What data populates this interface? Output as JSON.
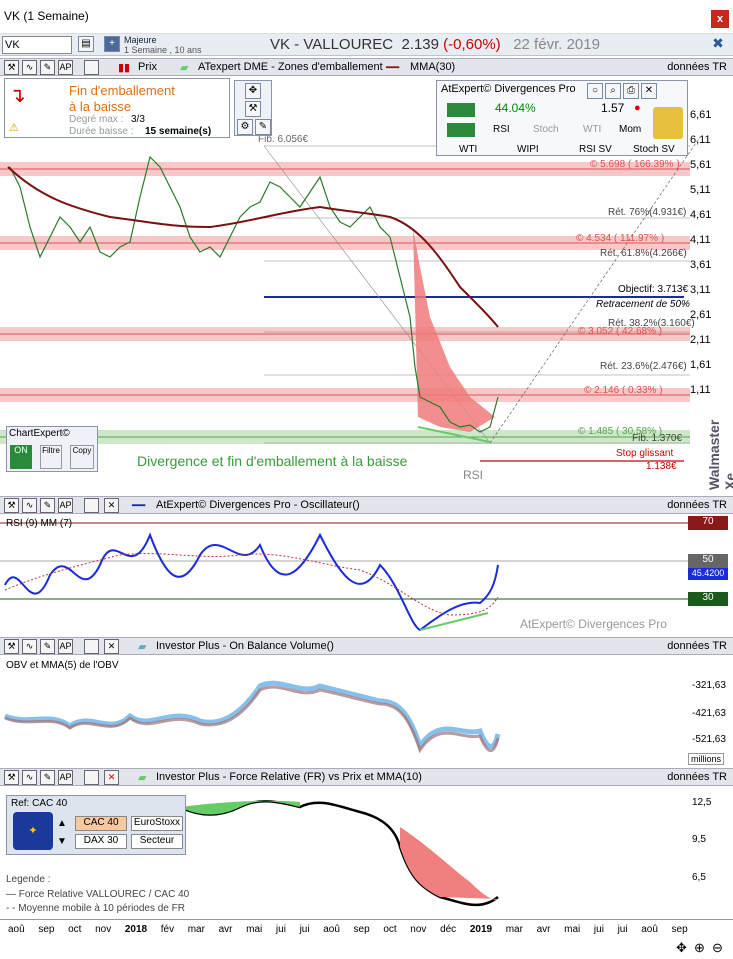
{
  "window": {
    "title": "VK (1 Semaine)",
    "close": "x"
  },
  "toolbar": {
    "symbol": "VK",
    "majeure_label": "Majeure",
    "majeure_sub": "1 Semaine , 10 ans",
    "headline_name": "VK - VALLOUREC",
    "headline_price": "2.139",
    "headline_change": "(-0,60%)",
    "headline_date": "22 févr. 2019"
  },
  "panel1": {
    "prix": "Prix",
    "zones": "ATexpert DME - Zones d'emballement",
    "mma": "MMA(30)",
    "donnees": "données TR",
    "alert_title": "Fin d'emballement",
    "alert_sub": "à la baisse",
    "degre_label": "Degré max :",
    "degre_value": "3/3",
    "duree_label": "Durée baisse :",
    "duree_value": "15 semaine(s)",
    "fib_top": "Fib. 6.056€",
    "level_5698": "© 5.698 ( 166.39% )",
    "level_4534": "© 4.534 ( 111.97% )",
    "level_3052": "© 3.052 ( 42.68% )",
    "level_2146": "© 2.146 ( 0.33% )",
    "level_1485": "© 1.485 ( 30.58% )",
    "ret76": "Rét. 76%(4.931€)",
    "ret618": "Rét. 61.8%(4.266€)",
    "objectif": "Objectif: 3.713€",
    "retr50": "Retracement de 50%",
    "ret382": "Rét. 38.2%(3.160€)",
    "ret236": "Rét. 23.6%(2.476€)",
    "fib_bot": "Fib. 1.370€",
    "stop": "Stop glissant",
    "stop_val": "1.138€",
    "rsi": "RSI",
    "divergence": "Divergence  et fin d'emballement à la baisse",
    "chartexpert": "ChartExpert©",
    "btn_on": "ON",
    "btn_filtre": "Filtre",
    "btn_copy": "Copy",
    "yticks": [
      "6,61",
      "6,11",
      "5,61",
      "5,11",
      "4,61",
      "4,11",
      "3,61",
      "3,11",
      "2,61",
      "2,11",
      "1,61",
      "1,11"
    ],
    "watermark": "Walmaster Xe"
  },
  "divpro": {
    "title": "AtExpert© Divergences Pro",
    "pct": "44.04%",
    "val": "1.57",
    "chk": [
      "RSI",
      "Stoch",
      "WTI",
      "Mom"
    ],
    "chk2": [
      "WTI",
      "WIPI",
      "RSI SV",
      "Stoch SV"
    ]
  },
  "panel2": {
    "title": "AtExpert© Divergences Pro - Oscillateur()",
    "donnees": "données TR",
    "sub": "RSI (9) MM (7)",
    "y70": "70",
    "y50": "50",
    "y30": "30",
    "cur": "45.4200",
    "watermark": "AtExpert© Divergences Pro"
  },
  "panel3": {
    "title": "Investor Plus - On Balance Volume()",
    "donnees": "données TR",
    "sub": "OBV et MMA(5) de l'OBV",
    "yticks": [
      "-321,63",
      "-421,63",
      "-521,63"
    ],
    "unit": "millions"
  },
  "panel4": {
    "title": "Investor Plus - Force Relative (FR) vs Prix et MMA(10)",
    "donnees": "données TR",
    "ref": "Ref: CAC 40",
    "btns": [
      "CAC 40",
      "EuroStoxx",
      "DAX 30",
      "Secteur"
    ],
    "legend_title": "Legende :",
    "legend1": "Force Relative VALLOUREC / CAC 40",
    "legend2": "Moyenne mobile à 10 périodes de FR",
    "yticks": [
      "12,5",
      "9,5",
      "6,5"
    ]
  },
  "xaxis": [
    "aoû",
    "sep",
    "oct",
    "nov",
    "2018",
    "fév",
    "mar",
    "avr",
    "mai",
    "jui",
    "jui",
    "aoû",
    "sep",
    "oct",
    "nov",
    "déc",
    "2019",
    "mar",
    "avr",
    "mai",
    "jui",
    "jui",
    "aoû",
    "sep"
  ]
}
